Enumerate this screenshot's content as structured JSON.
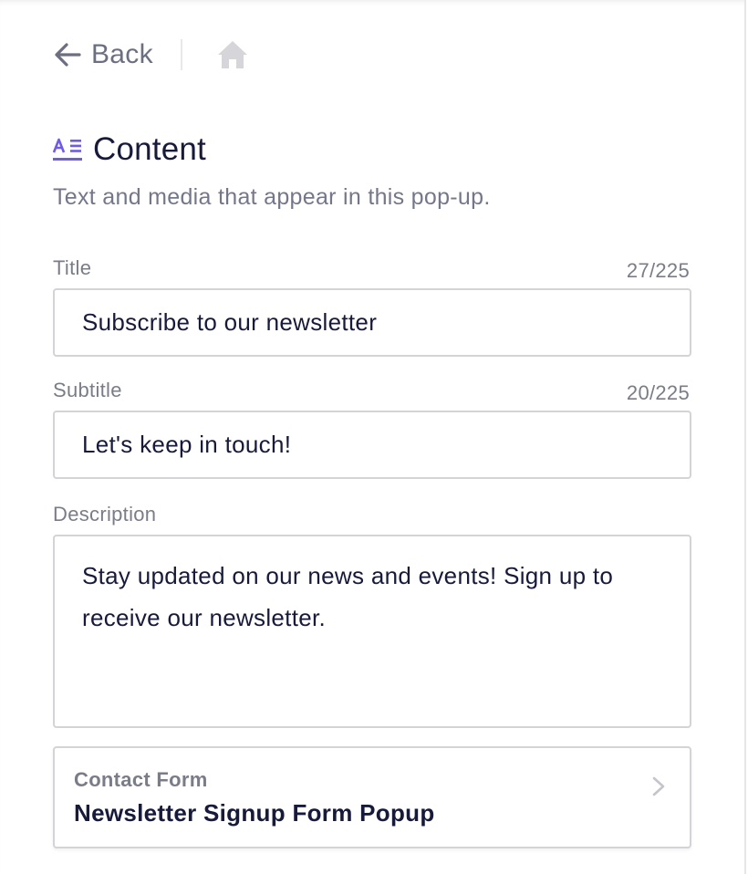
{
  "nav": {
    "back_label": "Back",
    "back_icon": "arrow-left-icon",
    "home_icon": "home-icon"
  },
  "section": {
    "icon": "text-format-icon",
    "title": "Content",
    "description": "Text and media that appear in this pop-up."
  },
  "fields": {
    "title": {
      "label": "Title",
      "counter": "27/225",
      "value": "Subscribe to our newsletter"
    },
    "subtitle": {
      "label": "Subtitle",
      "counter": "20/225",
      "value": "Let's keep in touch!"
    },
    "description": {
      "label": "Description",
      "value": "Stay updated on our news and events! Sign up to receive our newsletter."
    }
  },
  "contact_form": {
    "label": "Contact Form",
    "value": "Newsletter Signup Form Popup",
    "icon": "chevron-right-icon"
  },
  "colors": {
    "accent": "#6e5ce6",
    "text_primary": "#171a3a",
    "text_muted": "#74778a",
    "border": "#d3d3d8"
  }
}
